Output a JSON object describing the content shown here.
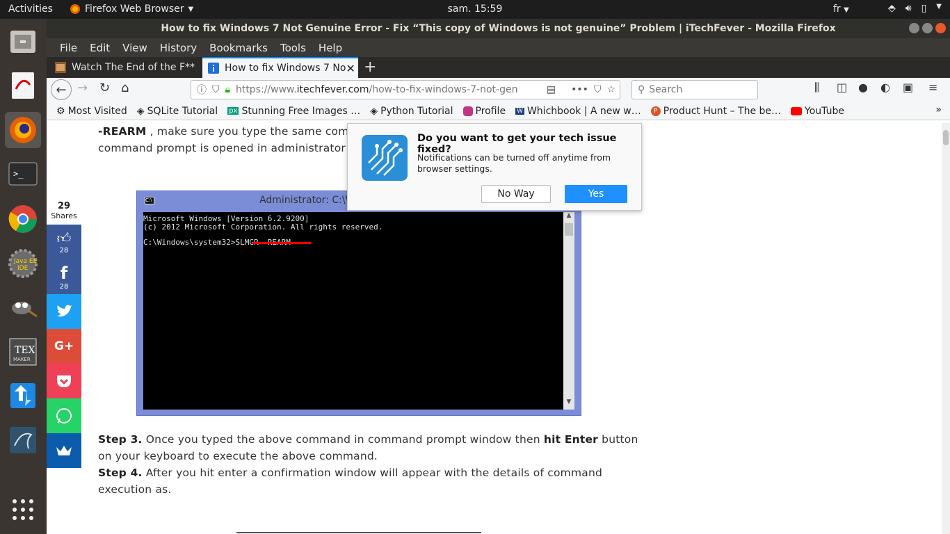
{
  "topbar": {
    "activities": "Activities",
    "app_name": "Firefox Web Browser",
    "clock": "sam. 15:59",
    "lang": "fr"
  },
  "window": {
    "title": "How to fix Windows 7 Not Genuine Error - Fix “This copy of Windows is not genuine” Problem | iTechFever - Mozilla Firefox"
  },
  "menu": [
    "File",
    "Edit",
    "View",
    "History",
    "Bookmarks",
    "Tools",
    "Help"
  ],
  "tabs": [
    {
      "label": "Watch The End of the F**"
    },
    {
      "label": "How to fix Windows 7 No"
    }
  ],
  "url": {
    "scheme": "https://www.",
    "host": "itechfever.com",
    "path": "/how-to-fix-windows-7-not-gen"
  },
  "search": {
    "placeholder": "Search"
  },
  "bookmarks": [
    "Most Visited",
    "SQLite Tutorial",
    "Stunning Free Images …",
    "Python Tutorial",
    "Profile",
    "Whichbook | A new w…",
    "Product Hunt – The be…",
    "YouTube"
  ],
  "article": {
    "top_line1_bold": "-REARM",
    "top_line1_rest": " , make sure you type the same com",
    "top_line2": "command prompt is opened in administrator m",
    "step3_label": "Step 3.",
    "step3_a": " Once you typed the above command in command prompt window then ",
    "step3_bold": "hit Enter",
    "step3_b": " button",
    "step3_line2": "on your keyboard to execute the above command.",
    "step4_label": "Step 4.",
    "step4_a": " After you hit enter a confirmation window will appear with the details of command",
    "step4_line2": "execution as."
  },
  "shares": {
    "count": "29",
    "label": "Shares",
    "like_count": "28",
    "fb_count": "28"
  },
  "cmd": {
    "title": "Administrator: C:\\Wi",
    "line1": "Microsoft Windows [Version 6.2.9200]",
    "line2": "(c) 2012 Microsoft Corporation. All rights reserved.",
    "prompt": "C:\\Windows\\system32>",
    "command": "SLMGR -REARM"
  },
  "popup": {
    "title": "Do you want to get your tech issue fixed?",
    "body": "Notifications can be turned off anytime from browser settings.",
    "no": "No Way",
    "yes": "Yes"
  },
  "colors": {
    "accent": "#0a84ff",
    "yes_button": "#1e90ff",
    "like": "#3b5998",
    "facebook": "#3b5998",
    "twitter": "#1da1f2",
    "gplus": "#dd4b39",
    "pocket": "#ef4056",
    "whatsapp": "#25d366",
    "sumo": "#0b5cad"
  }
}
